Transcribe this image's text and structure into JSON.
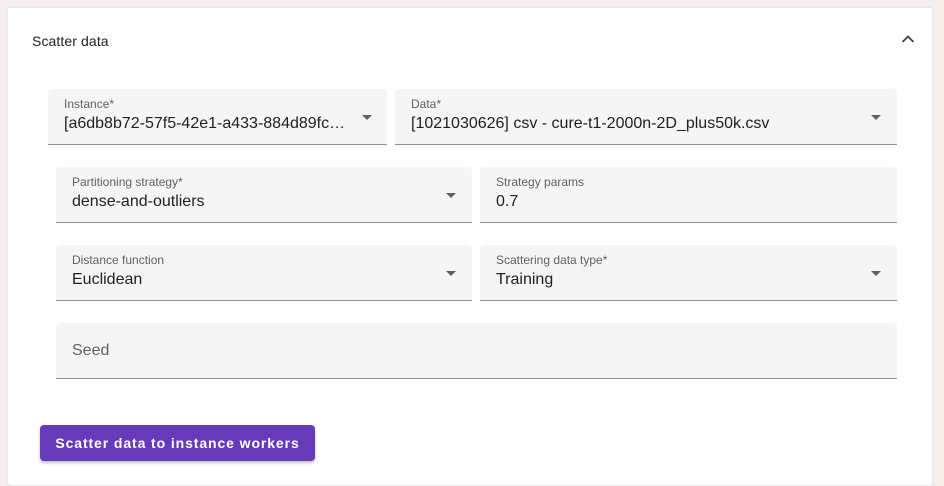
{
  "panel": {
    "title": "Scatter data"
  },
  "fields": {
    "instance": {
      "label": "Instance*",
      "value": "[a6db8b72-57f5-42e1-a433-884d89fc…"
    },
    "data": {
      "label": "Data*",
      "value": "[1021030626] csv - cure-t1-2000n-2D_plus50k.csv"
    },
    "partitioning_strategy": {
      "label": "Partitioning strategy*",
      "value": "dense-and-outliers"
    },
    "strategy_params": {
      "label": "Strategy params",
      "value": "0.7"
    },
    "distance_function": {
      "label": "Distance function",
      "value": "Euclidean"
    },
    "scattering_data_type": {
      "label": "Scattering data type*",
      "value": "Training"
    },
    "seed": {
      "placeholder": "Seed"
    }
  },
  "actions": {
    "scatter_button_label": "Scatter data to instance workers"
  },
  "colors": {
    "accent": "#673ab7",
    "field_bg": "#f5f5f5",
    "text_primary": "#212121",
    "text_secondary": "#616161"
  },
  "icons": {
    "collapse": "chevron-up-icon",
    "dropdown": "caret-down-icon"
  }
}
